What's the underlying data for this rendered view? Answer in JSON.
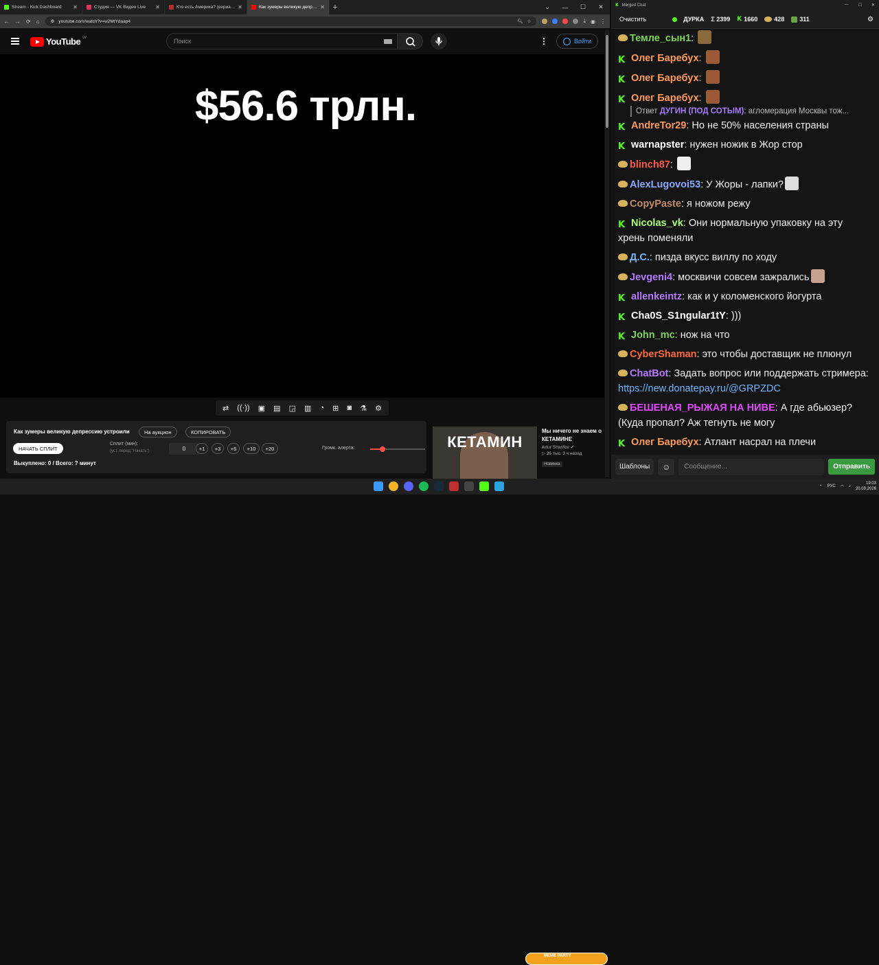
{
  "tabs": [
    {
      "label": "Stream - Kick Dashboard",
      "color": "#53fc18"
    },
    {
      "label": "Студия — VK Видео Live",
      "color": "#e2325a"
    },
    {
      "label": "Кто есть Америка? (сериал, 1...",
      "color": "#b03030"
    },
    {
      "label": "Как зумеры великую депресс...",
      "color": "#ff0000"
    }
  ],
  "address": "youtube.com/watch?v=w2MtYdaap4",
  "yt": {
    "logo": "YouTube",
    "region": "LV",
    "search_placeholder": "Поиск",
    "signin": "Войти"
  },
  "video": {
    "overlay_text": "$56.6 трлн."
  },
  "panel": {
    "title": "Как зумеры великую депрессию устроили",
    "auction_btn": "На аукцион",
    "copy_btn": "КОПИРОВАТЬ",
    "start_btn": "НАЧАТЬ СПЛИТ",
    "split_label": "Сплит (мин):",
    "split_sub": "(уст. перед \"Начать\")",
    "split_value": "0",
    "increments": [
      "+1",
      "+3",
      "+5",
      "+10",
      "+20"
    ],
    "volume_label": "Громк. алерта:",
    "volume_level": 0.23,
    "status": "Выкуплено: 0 / Всего: ? минут"
  },
  "recommended": {
    "thumb_text": "КЕТАМИН",
    "title": "Мы ничего не знаем о КЕТАМИНЕ",
    "author": "Artur Sharifov",
    "meta": "▷ 26 тыс.   3 ч назад",
    "badge": "Новинка"
  },
  "chat": {
    "window_title": "Merged Chat",
    "clear_btn": "Очистить",
    "channel": "ДУРКА",
    "total": "Σ 2399",
    "kick_count": "1660",
    "hat_count": "428",
    "other_count": "311",
    "templates_btn": "Шаблоны",
    "input_placeholder": "Сообщение...",
    "send_btn": "Отправить",
    "reply": {
      "prefix": "Ответ",
      "name": "ДУГИН (ПОД СОТЫМ)",
      "text": ": агломерация Москвы тож..."
    },
    "messages": [
      {
        "badge": "hat",
        "name": "Темле_сын1",
        "color": "#7fd35a",
        "text": "",
        "emote": "#8a6a3a"
      },
      {
        "badge": "kick",
        "name": "Олег Баребух",
        "color": "#ff9a5c",
        "text": "",
        "emote": "#9a5a3a"
      },
      {
        "badge": "kick",
        "name": "Олег Баребух",
        "color": "#ff9a5c",
        "text": "",
        "emote": "#9a5a3a"
      },
      {
        "badge": "kick",
        "name": "Олег Баребух",
        "color": "#ff9a5c",
        "text": "",
        "emote": "#9a5a3a"
      },
      {
        "badge": "kick",
        "name": "AndreTor29",
        "color": "#ff9a5c",
        "text": "Но не 50% населения страны"
      },
      {
        "badge": "kick",
        "name": "warnapster",
        "color": "#ffffff",
        "text": "нужен ножик в Жор стор"
      },
      {
        "badge": "hat",
        "name": "blinch87",
        "color": "#ff5a4a",
        "text": "",
        "emote": "#eeeeee"
      },
      {
        "badge": "hat",
        "name": "AlexLugovoi53",
        "color": "#8aa8ff",
        "text": "У Жоры - лапки?",
        "emote": "#dddddd"
      },
      {
        "badge": "hat",
        "name": "CopyPaste",
        "color": "#c48a6a",
        "text": "я ножом режу"
      },
      {
        "badge": "kick",
        "name": "Nicolas_vk",
        "color": "#aaff7a",
        "text": "Они нормальную упаковку на эту хрень поменяли"
      },
      {
        "badge": "hat",
        "name": "Д.С.",
        "color": "#7ab7ff",
        "text": "пизда вкусс виллу по ходу"
      },
      {
        "badge": "hat",
        "name": "Jevgeni4",
        "color": "#b57aff",
        "text": "москвичи совсем зажрались",
        "emote": "#c8a090"
      },
      {
        "badge": "kick",
        "name": "allenkeintz",
        "color": "#b57aff",
        "text": "как и у коломенского йогурта"
      },
      {
        "badge": "kick",
        "name": "Cha0S_S1ngular1tY",
        "color": "#ffffff",
        "text": ")))"
      },
      {
        "badge": "kick",
        "name": "John_mc",
        "color": "#7fd35a",
        "text": "нож на что"
      },
      {
        "badge": "hat",
        "name": "CyberShaman",
        "color": "#ff6a3a",
        "text": "это чтобы доставщик не плюнул"
      },
      {
        "badge": "hat",
        "name": "ChatBot",
        "color": "#b57aff",
        "text": "Задать вопрос или поддержать стримера: ",
        "link": "https://new.donatepay.ru/@GRPZDC"
      },
      {
        "badge": "hat",
        "name": "БЕШЕНАЯ_РЫЖАЯ НА НИВЕ",
        "color": "#e04aff",
        "text": "А где абьюзер? (Куда пропал? Аж тегнуть не могу"
      },
      {
        "badge": "kick",
        "name": "Олег Баребух",
        "color": "#ff9a5c",
        "text": "Атлант насрал на плечи"
      }
    ]
  },
  "taskbar": {
    "lang": "РУС",
    "time": "19:03",
    "date": "20.09.2026",
    "meme_party": "MEME PARTY"
  }
}
